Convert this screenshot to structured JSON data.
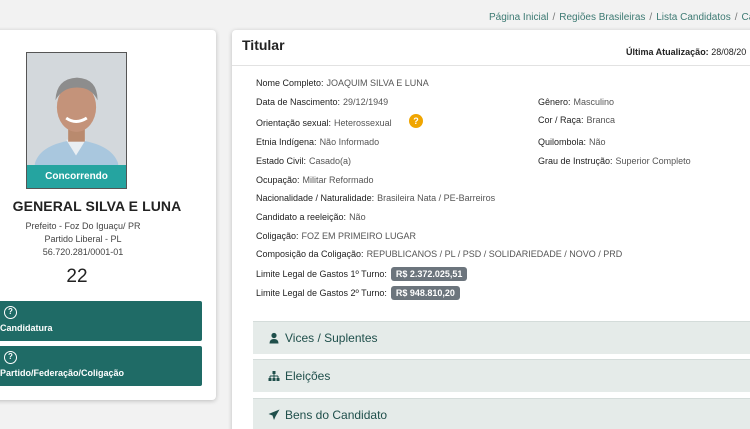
{
  "breadcrumb": {
    "items": [
      "Página Inicial",
      "Regiões Brasileiras",
      "Lista Candidatos",
      "Ca"
    ],
    "separator": "/"
  },
  "candidate": {
    "status": "Concorrendo",
    "name": "GENERAL SILVA E LUNA",
    "office": "Prefeito - Foz Do Iguaçu/ PR",
    "party": "Partido Liberal - PL",
    "cnpj": "56.720.281/0001-01",
    "number": "22",
    "buttons": [
      {
        "label": "Candidatura",
        "icon": "question-circle-icon"
      },
      {
        "label": "Partido/Federação/Coligação",
        "icon": "question-circle-icon"
      }
    ]
  },
  "details": {
    "title": "Titular",
    "last_update_label": "Última Atualização:",
    "last_update_value": "28/08/20",
    "fields": {
      "nome_completo": {
        "label": "Nome Completo:",
        "value": "JOAQUIM SILVA E LUNA"
      },
      "data_nascimento": {
        "label": "Data de Nascimento:",
        "value": "29/12/1949"
      },
      "genero": {
        "label": "Gênero:",
        "value": "Masculino"
      },
      "orientacao": {
        "label": "Orientação sexual:",
        "value": "Heterossexual"
      },
      "cor_raca": {
        "label": "Cor / Raça:",
        "value": "Branca"
      },
      "etnia": {
        "label": "Etnia Indígena:",
        "value": "Não Informado"
      },
      "quilombola": {
        "label": "Quilombola:",
        "value": "Não"
      },
      "estado_civil": {
        "label": "Estado Civil:",
        "value": "Casado(a)"
      },
      "grau_instrucao": {
        "label": "Grau de Instrução:",
        "value": "Superior Completo"
      },
      "ocupacao": {
        "label": "Ocupação:",
        "value": "Militar Reformado"
      },
      "nacionalidade": {
        "label": "Nacionalidade / Naturalidade:",
        "value": "Brasileira Nata / PE-Barreiros"
      },
      "reeleicao": {
        "label": "Candidato a reeleição:",
        "value": "Não"
      },
      "coligacao": {
        "label": "Coligação:",
        "value": "FOZ EM PRIMEIRO LUGAR"
      },
      "composicao": {
        "label": "Composição da Coligação:",
        "value": "REPUBLICANOS / PL / PSD / SOLIDARIEDADE / NOVO / PRD"
      },
      "limite_1": {
        "label": "Limite Legal de Gastos 1º Turno:",
        "value": "R$ 2.372.025,51"
      },
      "limite_2": {
        "label": "Limite Legal de Gastos 2º Turno:",
        "value": "R$ 948.810,20"
      }
    },
    "help_icon_text": "?"
  },
  "accordions": [
    {
      "label": "Vices / Suplentes",
      "icon": "user-icon"
    },
    {
      "label": "Eleições",
      "icon": "sitemap-icon"
    },
    {
      "label": "Bens do Candidato",
      "icon": "paper-plane-icon"
    }
  ],
  "colors": {
    "accent": "#1f6b66",
    "badge": "#25a4a0",
    "help": "#f0a500",
    "money_badge": "#6c757d"
  }
}
